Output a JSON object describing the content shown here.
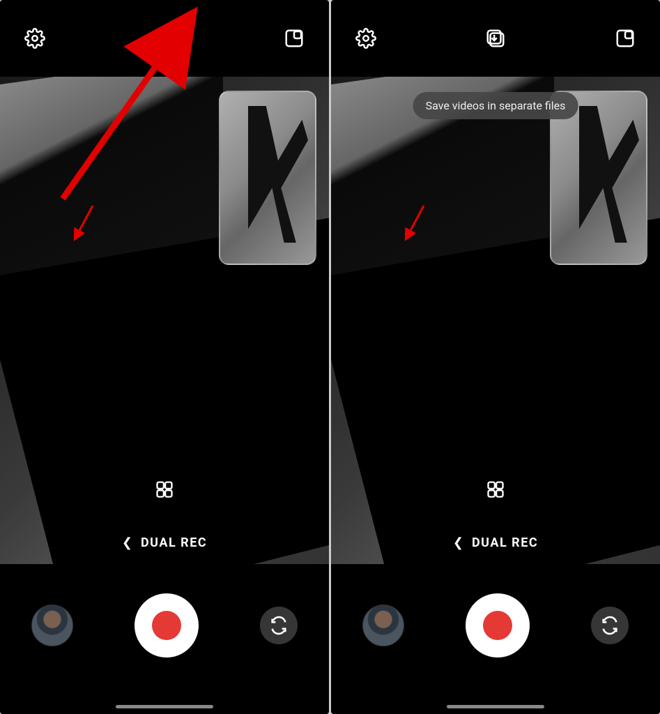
{
  "left": {
    "topbar": {
      "settings_icon": "settings",
      "save_icon": "save-single",
      "pip_icon": "pip-layout"
    },
    "mode_label": "DUAL REC",
    "tooltip": null
  },
  "right": {
    "topbar": {
      "settings_icon": "settings",
      "save_icon": "save-multi",
      "pip_icon": "pip-layout"
    },
    "mode_label": "DUAL REC",
    "tooltip": "Save videos in separate files"
  },
  "colors": {
    "record_red": "#e53935",
    "callout_red": "#e20000"
  }
}
